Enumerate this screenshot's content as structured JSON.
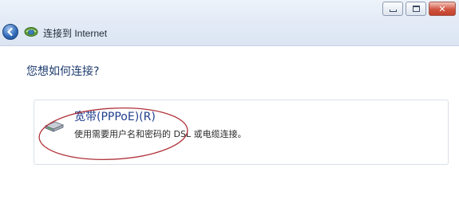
{
  "window": {
    "title": "连接到 Internet",
    "controls": {
      "minimize_icon": "minimize-icon",
      "maximize_icon": "maximize-icon",
      "close_icon": "close-icon",
      "close_glyph": "✕"
    }
  },
  "navigation": {
    "back_icon": "back-arrow-icon"
  },
  "page": {
    "question": "您想如何连接?",
    "options": [
      {
        "title": "宽带(PPPoE)(R)",
        "description": "使用需要用户名和密码的 DSL 或电缆连接。",
        "icon": "broadband-modem-icon"
      }
    ]
  },
  "colors": {
    "title_text": "#1e2a3a",
    "question_text": "#1d3b6e",
    "option_title": "#1f3d8c",
    "annotation": "#b0333a"
  }
}
